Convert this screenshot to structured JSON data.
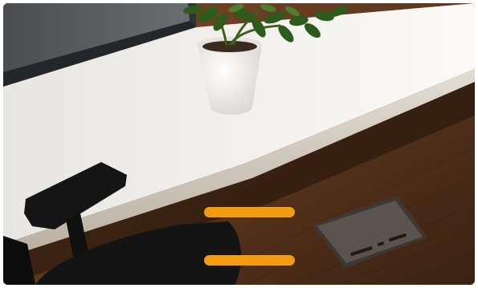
{
  "scene": {
    "description_icon": "desk-with-potted-plant-and-chair-image"
  },
  "controls": {
    "accent_color": "#f39c12",
    "bars": [
      {
        "id": "top-bar"
      },
      {
        "id": "bottom-bar"
      }
    ]
  },
  "colors": {
    "desk_top": "#f1efec",
    "desk_edge": "#d6d0c6",
    "floor": "#5a3620",
    "window_dark": "#3a3d40",
    "plant_leaf": "#2f5a1f",
    "pot": "#f3f1ec",
    "chair": "#141414",
    "floor_box": "#4a4440"
  }
}
